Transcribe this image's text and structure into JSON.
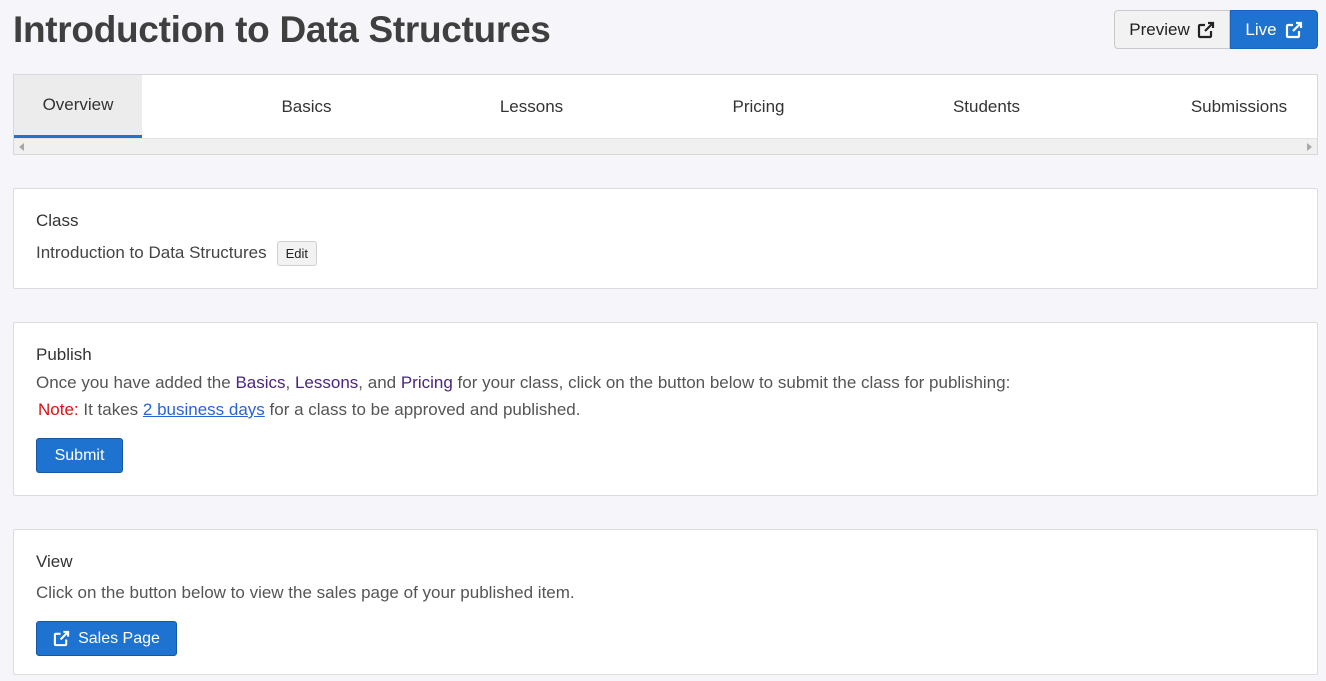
{
  "header": {
    "title": "Introduction to Data Structures",
    "preview_label": "Preview",
    "live_label": "Live"
  },
  "tabs": [
    {
      "label": "Overview",
      "active": true
    },
    {
      "label": "Basics"
    },
    {
      "label": "Lessons"
    },
    {
      "label": "Pricing"
    },
    {
      "label": "Students"
    },
    {
      "label": "Submissions"
    }
  ],
  "class_card": {
    "heading": "Class",
    "name": "Introduction to Data Structures",
    "edit_label": "Edit"
  },
  "publish_card": {
    "heading": "Publish",
    "line1_prefix": "Once you have added the ",
    "link_basics": "Basics",
    "sep1": ", ",
    "link_lessons": "Lessons",
    "sep2": ", and ",
    "link_pricing": "Pricing",
    "line1_suffix": " for your class, click on the button below to submit the class for publishing:",
    "note_label": "Note:",
    "note_prefix": " It takes ",
    "note_link": "2 business days",
    "note_suffix": " for a class to be approved and published.",
    "submit_label": "Submit"
  },
  "view_card": {
    "heading": "View",
    "text": "Click on the button below to view the sales page of your published item.",
    "sales_label": "Sales Page"
  },
  "icons": {
    "external_link": "external-link-icon"
  },
  "colors": {
    "accent": "#1e73d0",
    "link_purple": "#4b2580",
    "note_red": "#e01010",
    "link_blue": "#2864d6"
  }
}
